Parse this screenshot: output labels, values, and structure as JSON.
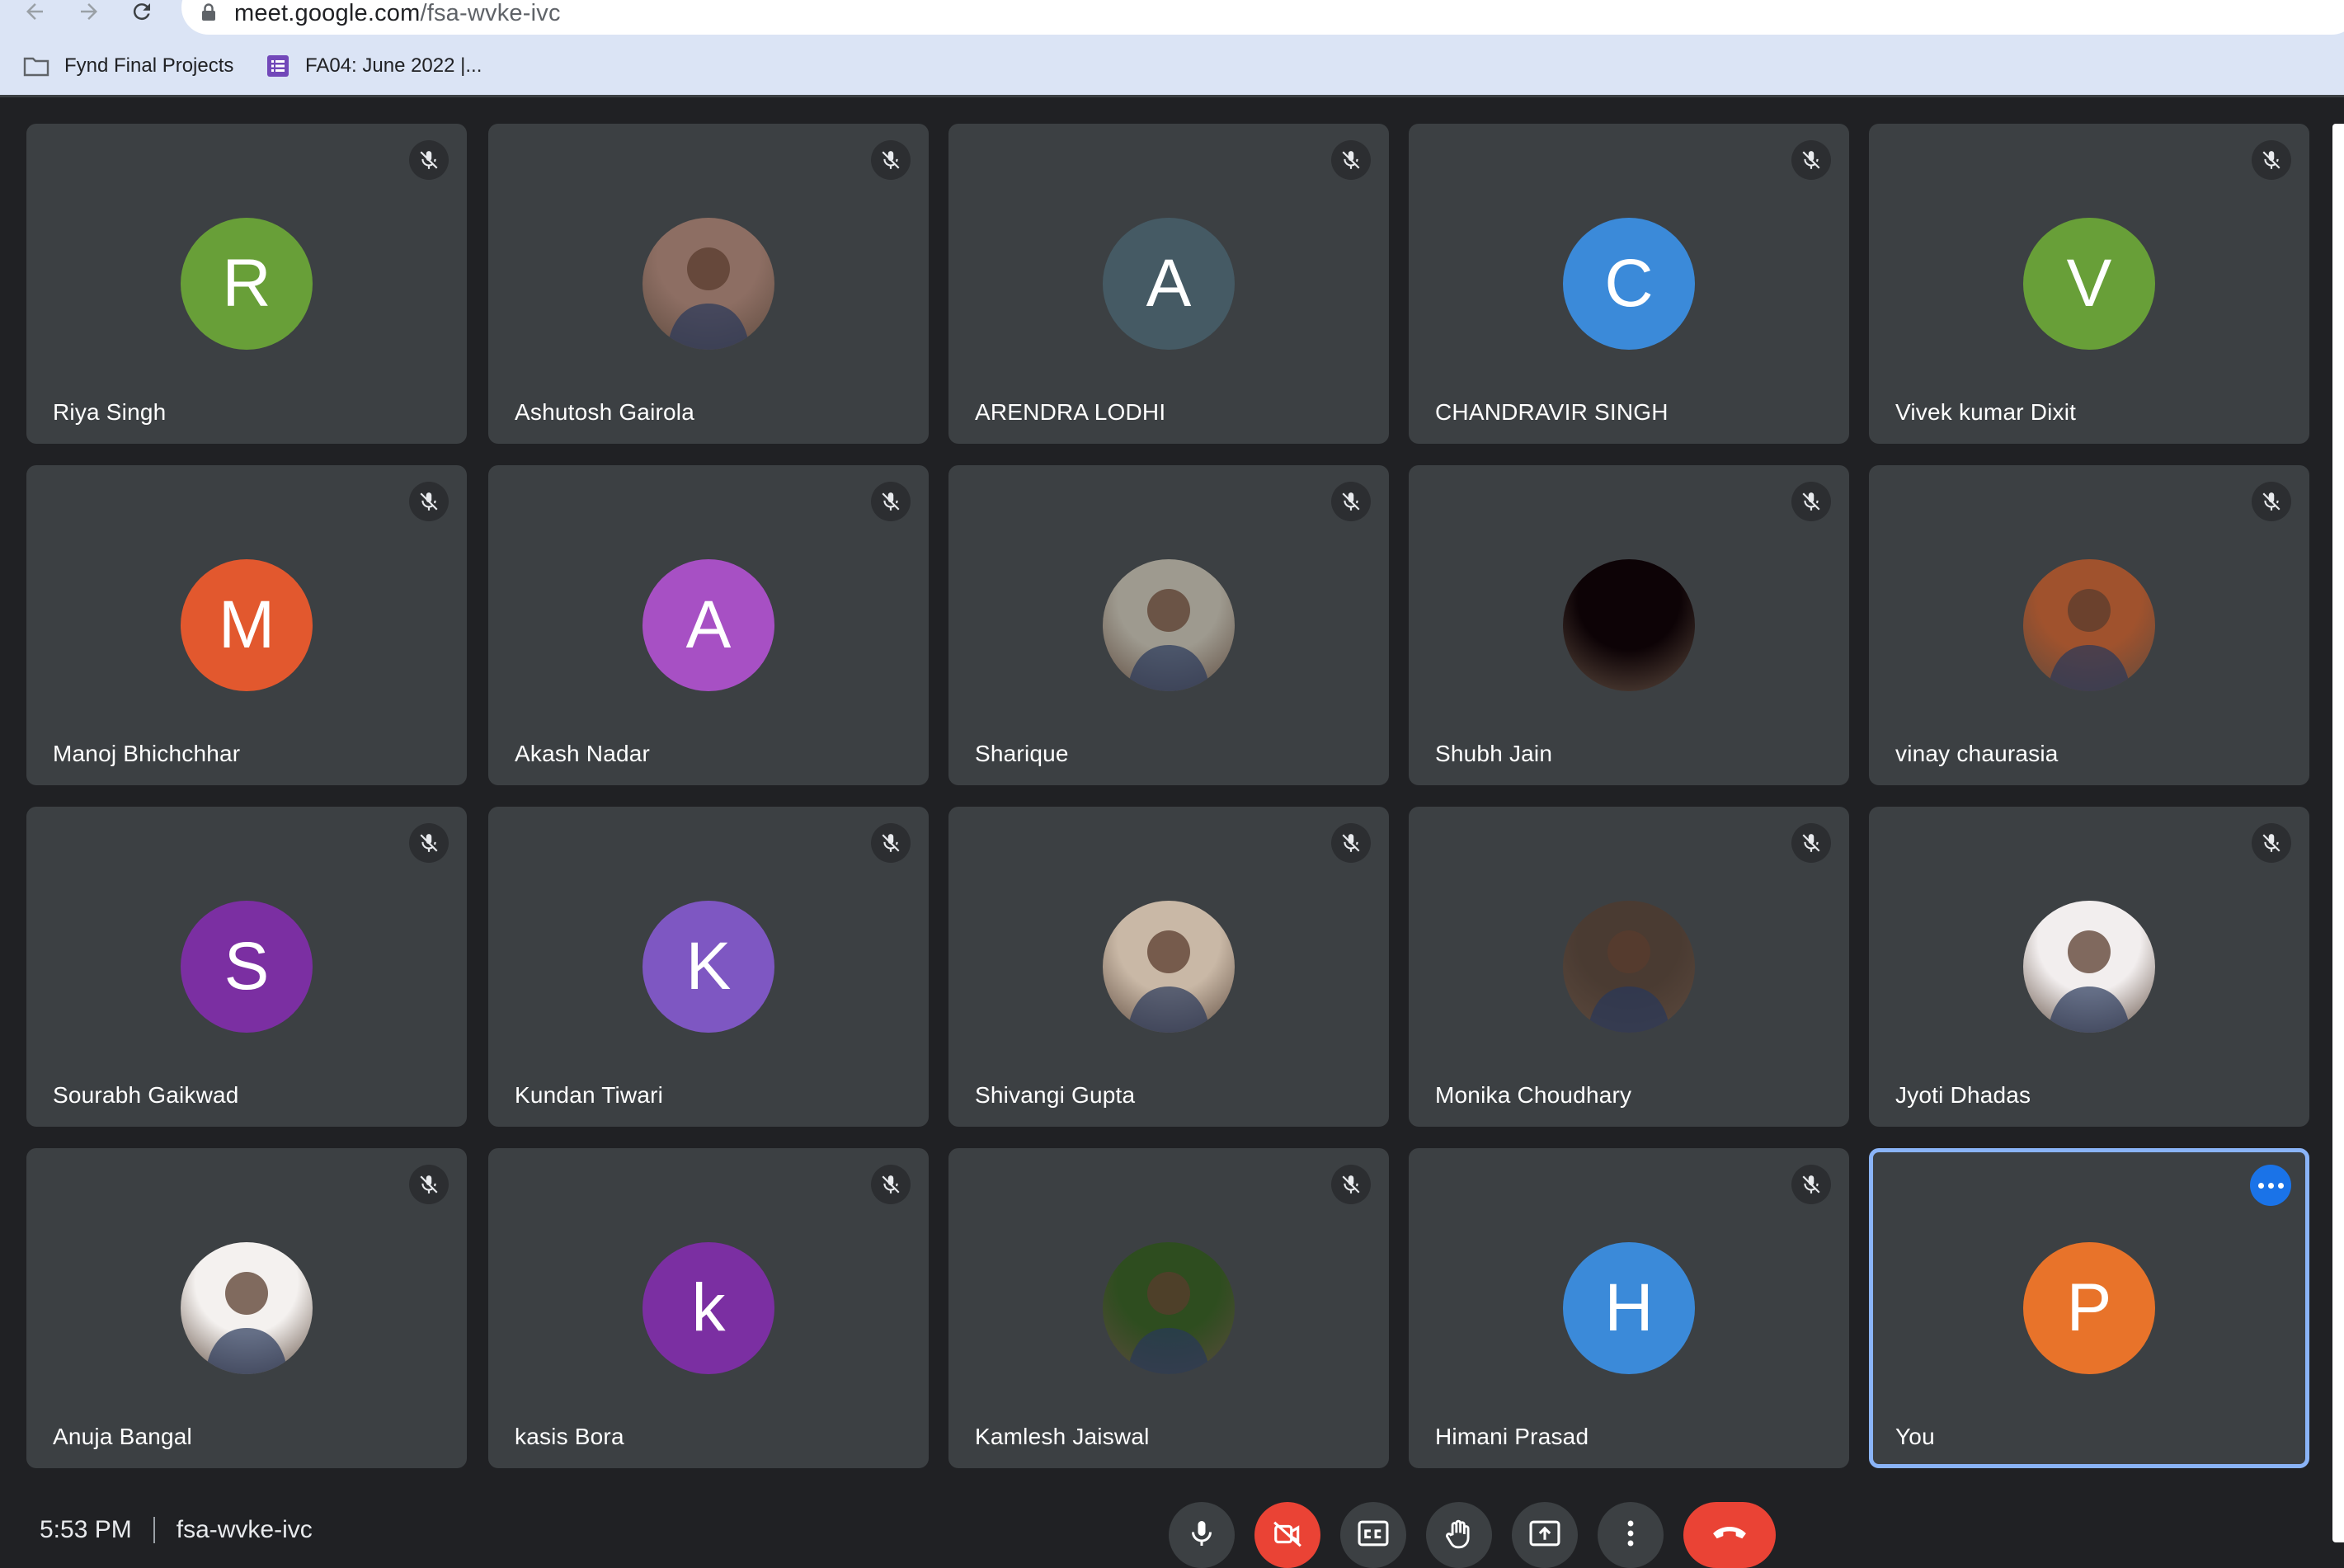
{
  "browser": {
    "url_host": "meet.google.com",
    "url_path": "/fsa-wvke-ivc",
    "bookmarks": [
      {
        "label": "Fynd Final Projects",
        "icon": "folder-icon"
      },
      {
        "label": "FA04: June 2022 |...",
        "icon": "sheets-icon"
      }
    ]
  },
  "colors": {
    "accent": "#8ab4f8",
    "tile_bg": "#3c4043",
    "stage_bg": "#202124",
    "danger": "#ea4335"
  },
  "participants": [
    {
      "name": "Riya Singh",
      "initial": "R",
      "color": "#689f38",
      "muted": true
    },
    {
      "name": "Ashutosh Gairola",
      "initial": "",
      "photo": true,
      "color": "#8d6e63",
      "muted": true
    },
    {
      "name": "ARENDRA LODHI",
      "initial": "A",
      "color": "#455a64",
      "muted": true
    },
    {
      "name": "CHANDRAVIR SINGH",
      "initial": "C",
      "color": "#3b8ad9",
      "muted": true
    },
    {
      "name": "Vivek kumar Dixit",
      "initial": "V",
      "color": "#689f38",
      "muted": true
    },
    {
      "name": "Manoj Bhichchhar",
      "initial": "M",
      "color": "#e2582e",
      "muted": true
    },
    {
      "name": "Akash Nadar",
      "initial": "A",
      "color": "#a750c4",
      "muted": true
    },
    {
      "name": "Sharique",
      "initial": "",
      "photo": true,
      "color": "#9e9a8f",
      "muted": true
    },
    {
      "name": "Shubh Jain",
      "initial": "",
      "photo": true,
      "color": "#0d0306",
      "muted": true
    },
    {
      "name": "vinay chaurasia",
      "initial": "",
      "photo": true,
      "color": "#a0522d",
      "muted": true
    },
    {
      "name": "Sourabh Gaikwad",
      "initial": "S",
      "color": "#7b2fa2",
      "muted": true
    },
    {
      "name": "Kundan Tiwari",
      "initial": "K",
      "color": "#7e57c2",
      "muted": true
    },
    {
      "name": "Shivangi Gupta",
      "initial": "",
      "photo": true,
      "color": "#c9b8a6",
      "muted": true
    },
    {
      "name": "Monika Choudhary",
      "initial": "",
      "photo": true,
      "color": "#4a3b32",
      "muted": true
    },
    {
      "name": "Jyoti Dhadas",
      "initial": "",
      "photo": true,
      "color": "#f2eeee",
      "muted": true
    },
    {
      "name": "Anuja Bangal",
      "initial": "",
      "photo": true,
      "color": "#f4f1ef",
      "muted": true
    },
    {
      "name": "kasis Bora",
      "initial": "k",
      "color": "#7b2fa2",
      "muted": true
    },
    {
      "name": "Kamlesh Jaiswal",
      "initial": "",
      "photo": true,
      "color": "#2e4d1f",
      "muted": true
    },
    {
      "name": "Himani Prasad",
      "initial": "H",
      "color": "#3b8ad9",
      "muted": true
    },
    {
      "name": "You",
      "initial": "P",
      "color": "#e8732a",
      "muted": false,
      "self": true
    }
  ],
  "meeting": {
    "time": "5:53 PM",
    "code": "fsa-wvke-ivc"
  },
  "controls": [
    {
      "name": "microphone-button",
      "icon": "microphone-icon"
    },
    {
      "name": "camera-off-button",
      "icon": "camera-off-icon"
    },
    {
      "name": "captions-button",
      "icon": "captions-icon"
    },
    {
      "name": "raise-hand-button",
      "icon": "hand-icon"
    },
    {
      "name": "present-screen-button",
      "icon": "present-icon"
    },
    {
      "name": "more-options-button",
      "icon": "more-vert-icon"
    },
    {
      "name": "leave-call-button",
      "icon": "phone-hangup-icon"
    }
  ]
}
